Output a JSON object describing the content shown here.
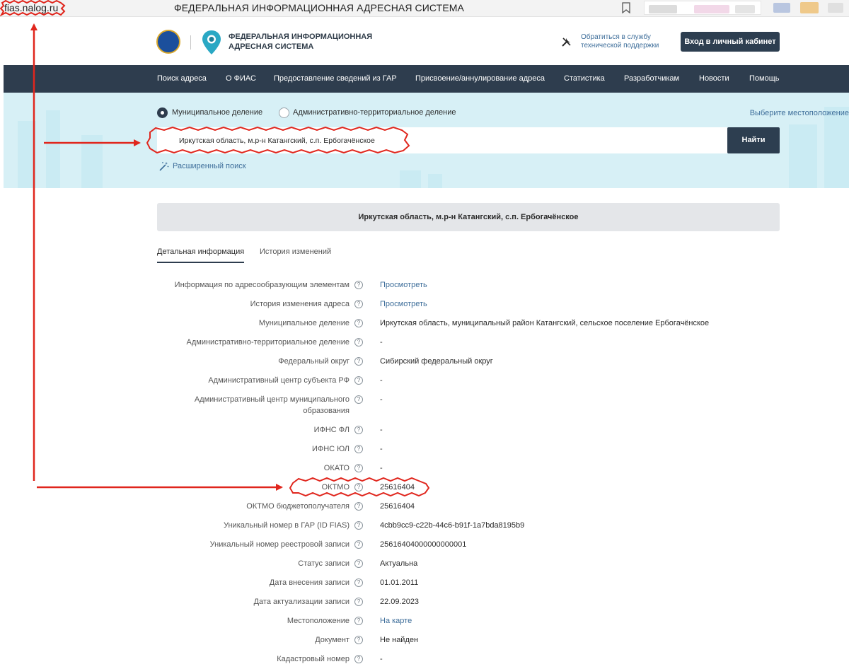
{
  "browser": {
    "url": "fias.nalog.ru",
    "tab_title": "ФЕДЕРАЛЬНАЯ ИНФОРМАЦИОННАЯ АДРЕСНАЯ СИСТЕМА"
  },
  "header": {
    "logo_line1": "ФЕДЕРАЛЬНАЯ ИНФОРМАЦИОННАЯ",
    "logo_line2": "АДРЕСНАЯ СИСТЕМА",
    "support_line1": "Обратиться в службу",
    "support_line2": "технической поддержки",
    "login_label": "Вход в личный кабинет"
  },
  "nav": {
    "items": [
      "Поиск адреса",
      "О ФИАС",
      "Предоставление сведений из ГАР",
      "Присвоение/аннулирование адреса",
      "Статистика",
      "Разработчикам",
      "Новости",
      "Помощь"
    ]
  },
  "search": {
    "radio_municipal": "Муниципальное деление",
    "radio_admin": "Административно-территориальное деление",
    "location_link": "Выберите местоположение",
    "query": "Иркутская область, м.р-н Катангский, с.п. Ербогачёнское",
    "find_label": "Найти",
    "advanced_label": "Расширенный поиск"
  },
  "result": {
    "title": "Иркутская область, м.р-н Катангский, с.п. Ербогачёнское",
    "tabs": [
      "Детальная информация",
      "История изменений"
    ]
  },
  "details": {
    "q_mark": "?",
    "rows": [
      {
        "label": "Информация по адресообразующим элементам",
        "value": "Просмотреть"
      },
      {
        "label": "История изменения адреса",
        "value": "Просмотреть"
      },
      {
        "label": "Муниципальное деление",
        "value": "Иркутская область, муниципальный район Катангский, сельское поселение Ербогачёнское"
      },
      {
        "label": "Административно-территориальное деление",
        "value": "-"
      },
      {
        "label": "Федеральный округ",
        "value": "Сибирский федеральный округ"
      },
      {
        "label": "Административный центр субъекта РФ",
        "value": "-"
      },
      {
        "label": "Административный центр муниципального",
        "label2": "образования",
        "value": "-"
      },
      {
        "label": "ИФНС ФЛ",
        "value": "-"
      },
      {
        "label": "ИФНС ЮЛ",
        "value": "-"
      },
      {
        "label": "ОКАТО",
        "value": "-"
      },
      {
        "label": "ОКТМО",
        "value": "25616404"
      },
      {
        "label": "ОКТМО бюджетополучателя",
        "value": "25616404"
      },
      {
        "label": "Уникальный номер в ГАР (ID FIAS)",
        "value": "4cbb9cc9-c22b-44c6-b91f-1a7bda8195b9"
      },
      {
        "label": "Уникальный номер реестровой записи",
        "value": "25616404000000000001"
      },
      {
        "label": "Статус записи",
        "value": "Актуальна"
      },
      {
        "label": "Дата внесения записи",
        "value": "01.01.2011"
      },
      {
        "label": "Дата актуализации записи",
        "value": "22.09.2023"
      },
      {
        "label": "Местоположение",
        "value": "На карте"
      },
      {
        "label": "Документ",
        "value": "Не найден"
      },
      {
        "label": "Кадастровый номер",
        "value": "-"
      }
    ]
  },
  "colors": {
    "nav_bg": "#2e3d4e",
    "button_bg": "#2d3e50",
    "search_band": "#d7f0f6",
    "link": "#3e6e9a",
    "annotation_red": "#e0261d"
  }
}
